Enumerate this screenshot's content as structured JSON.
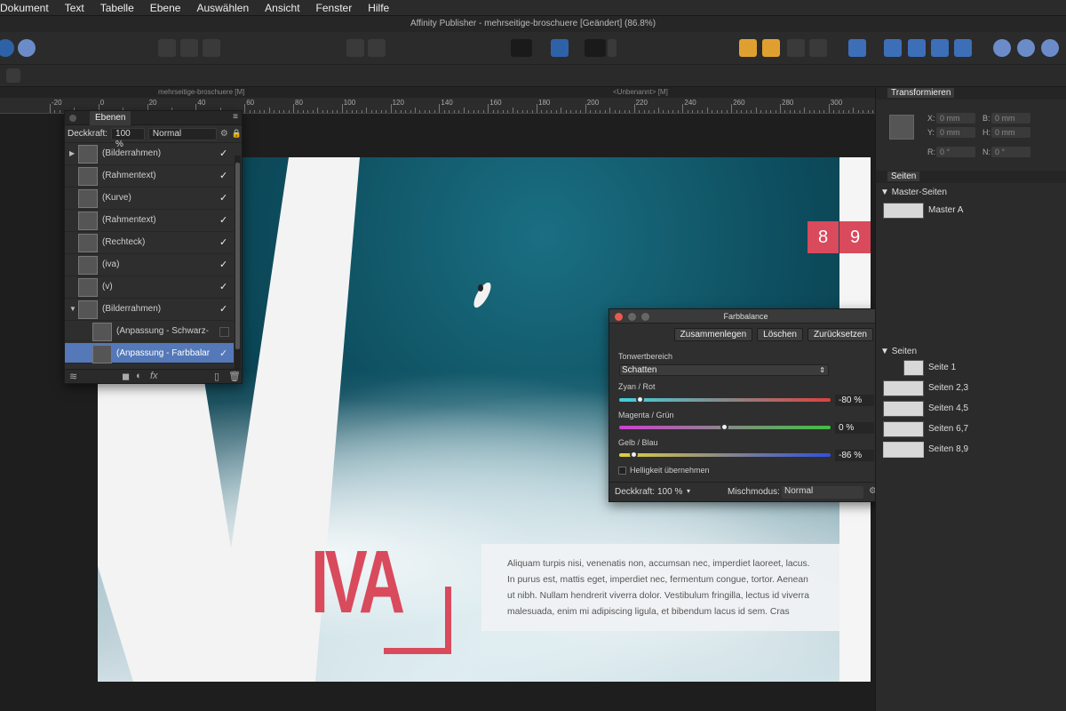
{
  "menu": [
    "Dokument",
    "Text",
    "Tabelle",
    "Ebene",
    "Auswählen",
    "Ansicht",
    "Fenster",
    "Hilfe"
  ],
  "window_title": "Affinity Publisher - mehrseitige-broschuere [Geändert] (86.8%)",
  "doc_tabs": {
    "left": "mehrseitige-broschuere [M]",
    "right": "<Unbenannt> [M]"
  },
  "ruler_labels": [
    "-20",
    "0",
    "20",
    "40",
    "60",
    "80",
    "100",
    "120",
    "140",
    "160",
    "180",
    "200",
    "220",
    "240",
    "260",
    "280",
    "300"
  ],
  "layers_panel": {
    "tab": "Ebenen",
    "opacity_label": "Deckkraft:",
    "opacity_value": "100 %",
    "blend_mode": "Normal",
    "rows": [
      {
        "label": "(Bilderrahmen)",
        "checked": true,
        "expander": "▶"
      },
      {
        "label": "(Rahmentext)",
        "checked": true
      },
      {
        "label": "(Kurve)",
        "checked": true
      },
      {
        "label": "(Rahmentext)",
        "checked": true
      },
      {
        "label": "(Rechteck)",
        "checked": true
      },
      {
        "label": "(iva)",
        "checked": true
      },
      {
        "label": "(v)",
        "checked": true
      },
      {
        "label": "(Bilderrahmen)",
        "checked": true,
        "expander": "▼"
      },
      {
        "label": "(Anpassung - Schwarz-",
        "checked": false
      },
      {
        "label": "(Anpassung - Farbbalar",
        "checked": true,
        "selected": true
      }
    ]
  },
  "document": {
    "page_numbers": [
      "8",
      "9"
    ],
    "headline": "IVA",
    "body_text": "Aliquam turpis nisi, venenatis non, accumsan nec, imperdiet laoreet, lacus. In purus est, mattis eget, imperdiet nec, fermentum congue, tortor. Aenean ut nibh. Nullam hendrerit viverra dolor. Vestibulum fringilla, lectus id viverra malesuada, enim mi adipiscing ligula, et bibendum lacus id sem. Cras",
    "accent_color": "#d94a5c"
  },
  "dialog": {
    "title": "Farbbalance",
    "buttons": [
      "Zusammenlegen",
      "Löschen",
      "Zurücksetzen"
    ],
    "tonal_range_label": "Tonwertbereich",
    "tonal_range_value": "Schatten",
    "sliders": [
      {
        "label": "Zyan / Rot",
        "value": "-80 %",
        "level": -80
      },
      {
        "label": "Magenta / Grün",
        "value": "0 %",
        "level": 0
      },
      {
        "label": "Gelb / Blau",
        "value": "-86 %",
        "level": -86
      }
    ],
    "preserve_luminosity": "Helligkeit übernehmen",
    "opacity_label": "Deckkraft:",
    "opacity_value": "100 %",
    "blend_label": "Mischmodus:",
    "blend_value": "Normal"
  },
  "transform_panel": {
    "title": "Transformieren",
    "fields": [
      {
        "label": "X:",
        "value": "0 mm"
      },
      {
        "label": "B:",
        "value": "0 mm"
      },
      {
        "label": "Y:",
        "value": "0 mm"
      },
      {
        "label": "H:",
        "value": "0 mm"
      },
      {
        "label": "R:",
        "value": "0 °"
      },
      {
        "label": "N:",
        "value": "0 °"
      }
    ]
  },
  "pages_panel": {
    "title": "Seiten",
    "master_section": "Master-Seiten",
    "master_items": [
      "Master A"
    ],
    "pages_section": "Seiten",
    "page_items": [
      "Seite 1",
      "Seiten 2,3",
      "Seiten 4,5",
      "Seiten 6,7",
      "Seiten 8,9"
    ]
  }
}
